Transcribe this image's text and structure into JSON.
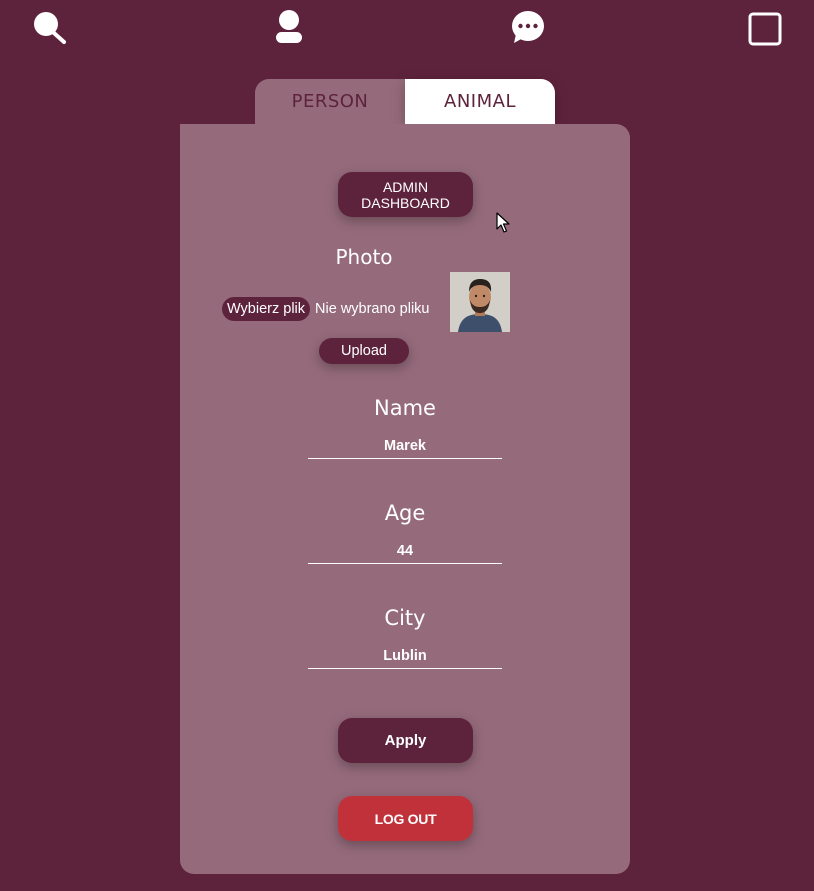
{
  "nav": {
    "icons": [
      "search-icon",
      "user-icon",
      "chat-icon",
      "window-icon"
    ]
  },
  "tabs": [
    {
      "label": "PERSON",
      "active": false
    },
    {
      "label": "ANIMAL",
      "active": true
    }
  ],
  "panel": {
    "admin_button": "ADMIN DASHBOARD",
    "photo_label": "Photo",
    "choose_file_button": "Wybierz plik",
    "no_file_text": "Nie wybrano pliku",
    "upload_button": "Upload",
    "fields": {
      "name": {
        "label": "Name",
        "value": "Marek"
      },
      "age": {
        "label": "Age",
        "value": "44"
      },
      "city": {
        "label": "City",
        "value": "Lublin"
      }
    },
    "apply_button": "Apply",
    "logout_button": "LOG OUT"
  },
  "colors": {
    "background": "#5e233c",
    "panel": "#956b7b",
    "button": "#5e233c",
    "logout": "#c1313a"
  }
}
